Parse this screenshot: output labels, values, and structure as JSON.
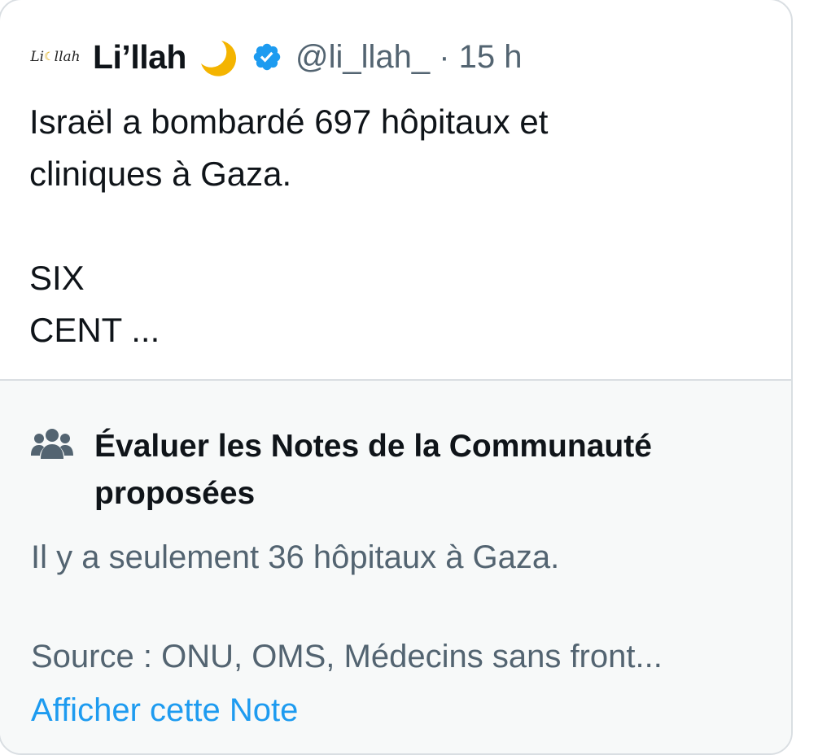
{
  "tweet": {
    "avatar_text": "Li",
    "avatar_text2": "llah",
    "display_name": "Li’llah",
    "handle_and_time": "@li_llah_ · 15 h",
    "text": "Israël a bombardé 697 hôpitaux et\ncliniques à Gaza.\n\nSIX\nCENT ...",
    "icons": {
      "name_emoji": "crescent-moon-icon",
      "badge": "verified-badge-icon"
    }
  },
  "community_note": {
    "icon": "people-icon",
    "title": "Évaluer les Notes de la Communauté proposées",
    "body": "Il y a seulement 36 hôpitaux à Gaza.",
    "source": "Source : ONU, OMS, Médecins sans front...",
    "link_label": "Afficher cette Note"
  },
  "colors": {
    "text_primary": "#0f1419",
    "text_secondary": "#536471",
    "link": "#1d9bf0",
    "note_background": "#f7f9f9",
    "border": "#d9dee2",
    "moon": "#f4b400"
  }
}
